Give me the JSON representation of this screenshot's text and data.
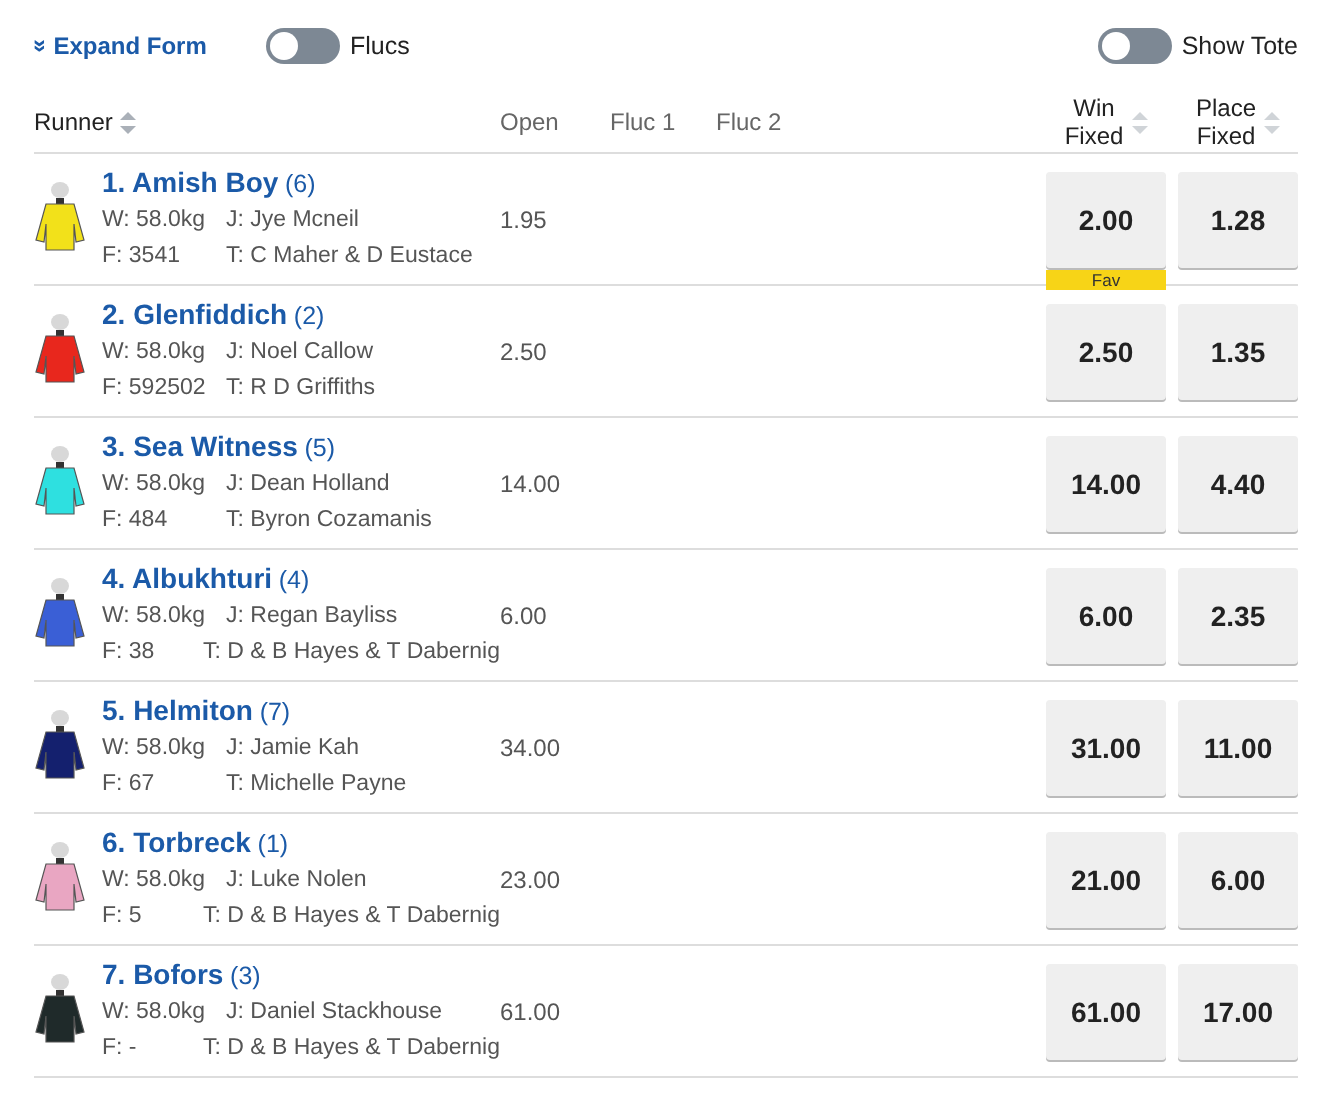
{
  "toolbar": {
    "expand_form": "Expand Form",
    "expand_icon": "»",
    "flucs": {
      "label": "Flucs",
      "on": false
    },
    "show_tote": {
      "label": "Show Tote",
      "on": false
    }
  },
  "columns": {
    "runner": "Runner",
    "open": "Open",
    "fluc_1": "Fluc 1",
    "fluc_2": "Fluc 2",
    "win": [
      "Win",
      "Fixed"
    ],
    "place": [
      "Place",
      "Fixed"
    ]
  },
  "runners": [
    {
      "name": "1. Amish Boy",
      "barrier": "(6)",
      "weight": "W: 58.0kg",
      "jockey": "J: Jye Mcneil",
      "form": "F: 3541",
      "trainer": "T: C Maher & D Eustace",
      "open": "1.95",
      "win": "2.00",
      "place": "1.28",
      "badge": "Fav",
      "color": "#f2e11a"
    },
    {
      "name": "2. Glenfiddich",
      "barrier": "(2)",
      "weight": "W: 58.0kg",
      "jockey": "J: Noel Callow",
      "form": "F: 592502",
      "trainer": "T: R D Griffiths",
      "open": "2.50",
      "win": "2.50",
      "place": "1.35",
      "color": "#e8271d"
    },
    {
      "name": "3. Sea Witness",
      "barrier": "(5)",
      "weight": "W: 58.0kg",
      "jockey": "J: Dean Holland",
      "form": "F: 484",
      "trainer": "T: Byron Cozamanis",
      "open": "14.00",
      "win": "14.00",
      "place": "4.40",
      "color": "#2ee0e0"
    },
    {
      "name": "4. Albukhturi",
      "barrier": "(4)",
      "weight": "W: 58.0kg",
      "jockey": "J: Regan Bayliss",
      "form": "F: 38",
      "trainer": "T: D & B Hayes & T Dabernig",
      "open": "6.00",
      "win": "6.00",
      "place": "2.35",
      "color": "#3a5fd6"
    },
    {
      "name": "5. Helmiton",
      "barrier": "(7)",
      "weight": "W: 58.0kg",
      "jockey": "J: Jamie Kah",
      "form": "F: 67",
      "trainer": "T: Michelle Payne",
      "open": "34.00",
      "win": "31.00",
      "place": "11.00",
      "color": "#14206e"
    },
    {
      "name": "6. Torbreck",
      "barrier": "(1)",
      "weight": "W: 58.0kg",
      "jockey": "J: Luke Nolen",
      "form": "F: 5",
      "trainer": "T: D & B Hayes & T Dabernig",
      "open": "23.00",
      "win": "21.00",
      "place": "6.00",
      "color": "#e9a6c2"
    },
    {
      "name": "7. Bofors",
      "barrier": "(3)",
      "weight": "W: 58.0kg",
      "jockey": "J: Daniel Stackhouse",
      "form": "F: -",
      "trainer": "T: D & B Hayes & T Dabernig",
      "open": "61.00",
      "win": "61.00",
      "place": "17.00",
      "color": "#1f2a2a"
    }
  ]
}
